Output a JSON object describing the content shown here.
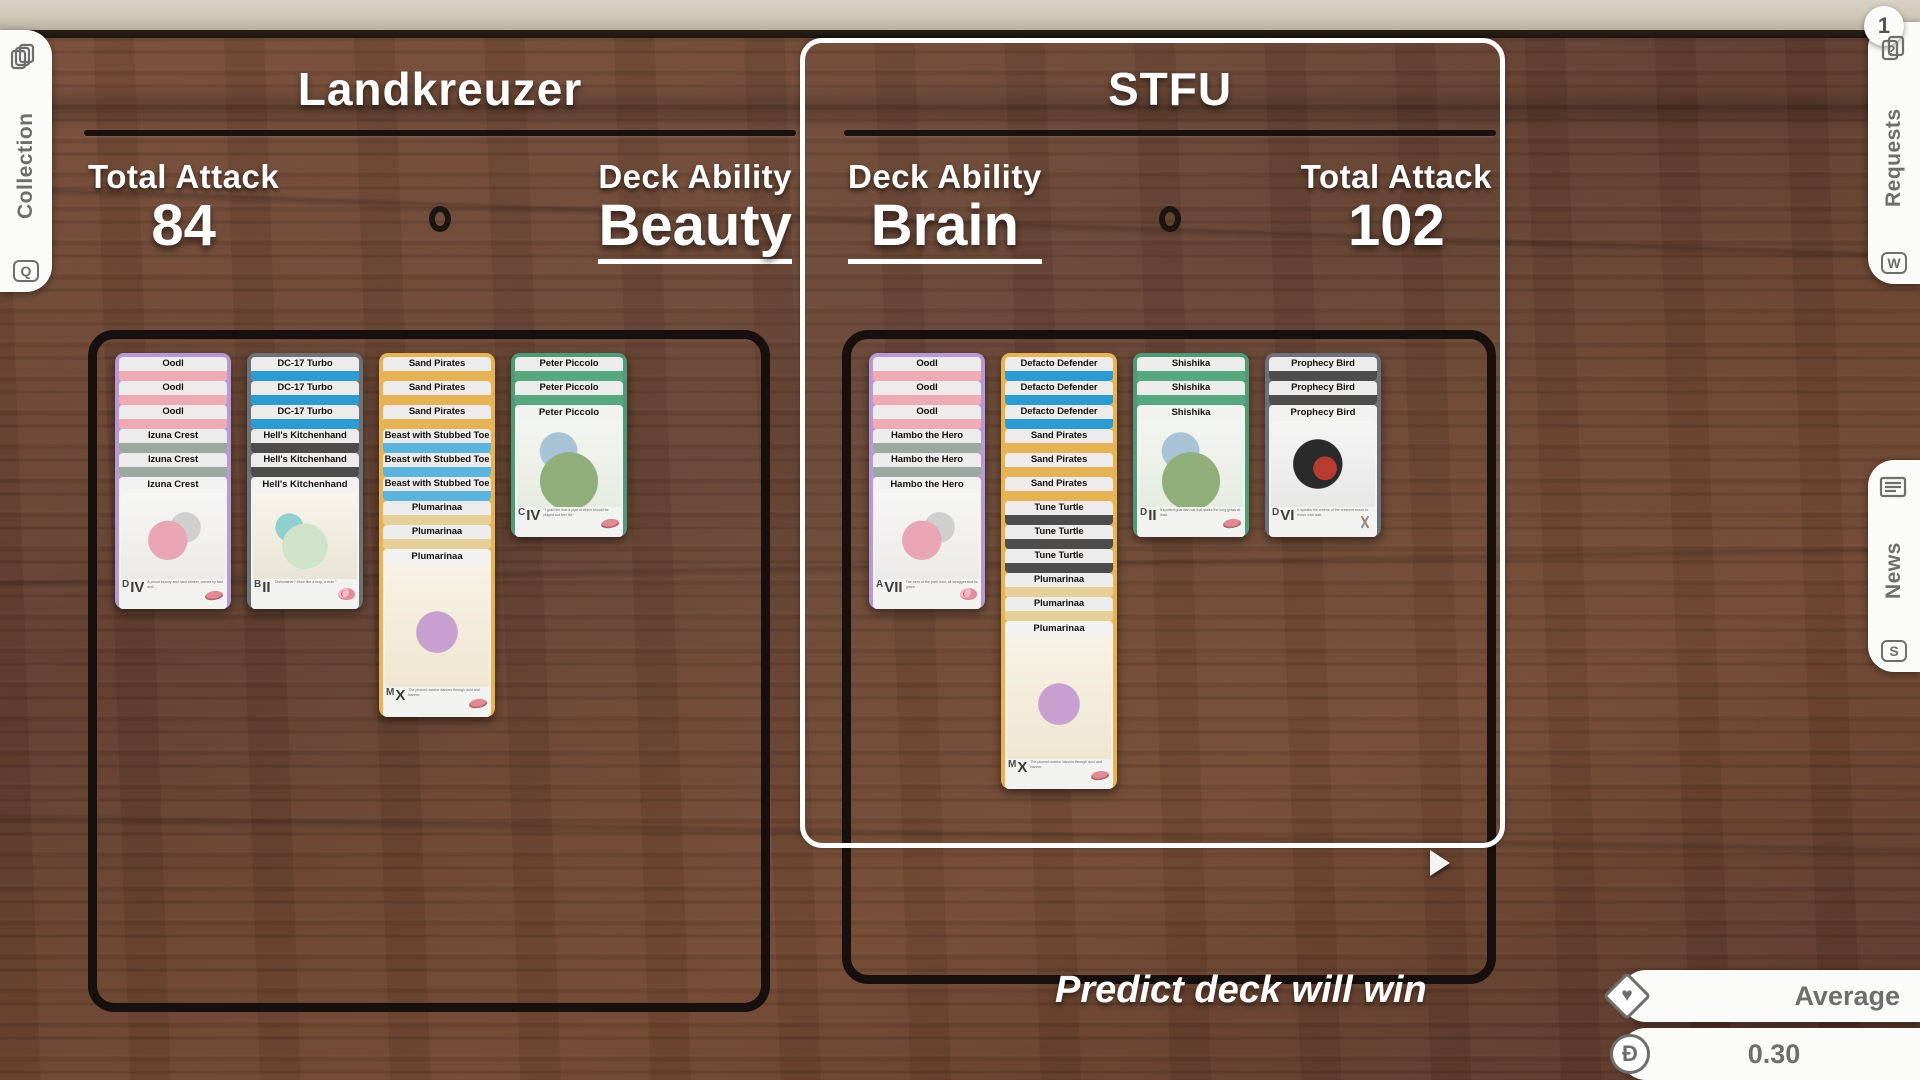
{
  "side_tabs": {
    "left": [
      {
        "name": "Collection",
        "label": "Collection",
        "key": "Q",
        "icon": "cards-stack-icon"
      }
    ],
    "right": [
      {
        "name": "Requests",
        "label": "Requests",
        "key": "W",
        "icon": "question-cards-icon",
        "badge": "1"
      },
      {
        "name": "News",
        "label": "News",
        "key": "S",
        "icon": "newspaper-icon"
      }
    ]
  },
  "decks": [
    {
      "title": "Landkreuzer",
      "selected": false,
      "left_stat_label": "Total Attack",
      "left_stat_value": "84",
      "right_stat_label": "Deck Ability",
      "right_stat_value": "Beauty",
      "stacks": [
        {
          "theme": "th-purple",
          "cards": [
            "Oodl",
            "Oodl",
            "Oodl",
            "Izuna Crest",
            "Izuna Crest",
            "Izuna Crest"
          ],
          "strip_colors": [
            "#f0aab4",
            "#f0aab4",
            "#f0aab4",
            "#9aa8a0",
            "#9aa8a0",
            "#9aa8a0"
          ],
          "rank": "D",
          "romans": "IV",
          "foot_desc": "A proud beauty and hard drinker, comes by fast and...",
          "suit": "lips"
        },
        {
          "theme": "th-gray",
          "cards": [
            "DC-17 Turbo",
            "DC-17 Turbo",
            "DC-17 Turbo",
            "Hell's Kitchenhand",
            "Hell's Kitchenhand",
            "Hell's Kitchenhand"
          ],
          "strip_colors": [
            "#2b9bd1",
            "#2b9bd1",
            "#2b9bd1",
            "#4c4c4c",
            "#4c4c4c",
            "#4c4c4c"
          ],
          "rank": "B",
          "romans": "II",
          "foot_desc": "\"Dishwasher? More like a mop, a man.\"",
          "suit": "brain"
        },
        {
          "theme": "th-yellow",
          "cards": [
            "Sand Pirates",
            "Sand Pirates",
            "Sand Pirates",
            "Beast with Stubbed Toe",
            "Beast with Stubbed Toe",
            "Beast with Stubbed Toe",
            "Plumarinaa",
            "Plumarinaa",
            "Plumarinaa"
          ],
          "strip_colors": [
            "#e7b256",
            "#e7b256",
            "#e7b256",
            "#5bb4dd",
            "#5bb4dd",
            "#5bb4dd",
            "#e7cf9a",
            "#e7cf9a",
            "#e7cf9a"
          ],
          "rank": "M",
          "romans": "X",
          "foot_desc": "The plumed warrior dances through dust and banner.",
          "suit": "lips",
          "tall": true
        },
        {
          "theme": "th-green",
          "cards": [
            "Peter Piccolo",
            "Peter Piccolo",
            "Peter Piccolo"
          ],
          "strip_colors": [
            "#57a87e",
            "#57a87e",
            "#57a87e"
          ],
          "rank": "C",
          "romans": "IV",
          "foot_desc": "\"I gold him that a pipe in which should be played out feel far.\"",
          "suit": "lips"
        }
      ]
    },
    {
      "title": "STFU",
      "selected": true,
      "left_stat_label": "Deck Ability",
      "left_stat_value": "Brain",
      "right_stat_label": "Total Attack",
      "right_stat_value": "102",
      "stacks": [
        {
          "theme": "th-purple",
          "cards": [
            "Oodl",
            "Oodl",
            "Oodl",
            "Hambo the Hero",
            "Hambo the Hero",
            "Hambo the Hero"
          ],
          "strip_colors": [
            "#f0aab4",
            "#f0aab4",
            "#f0aab4",
            "#9aa8a0",
            "#9aa8a0",
            "#9aa8a0"
          ],
          "rank": "A",
          "romans": "VII",
          "foot_desc": "The hero of the pork land, all swagger and no grace.",
          "suit": "brain"
        },
        {
          "theme": "th-yellow",
          "cards": [
            "Defacto Defender",
            "Defacto Defender",
            "Defacto Defender",
            "Sand Pirates",
            "Sand Pirates",
            "Sand Pirates",
            "Tune Turtle",
            "Tune Turtle",
            "Tune Turtle",
            "Plumarinaa",
            "Plumarinaa",
            "Plumarinaa"
          ],
          "strip_colors": [
            "#2b9bd1",
            "#2b9bd1",
            "#2b9bd1",
            "#e7b256",
            "#e7b256",
            "#e7b256",
            "#4c4c4c",
            "#4c4c4c",
            "#4c4c4c",
            "#e7cf9a",
            "#e7cf9a",
            "#e7cf9a"
          ],
          "rank": "M",
          "romans": "X",
          "foot_desc": "The plumed warrior dances through dust and banner.",
          "suit": "lips",
          "tall": true
        },
        {
          "theme": "th-green",
          "cards": [
            "Shishika",
            "Shishika",
            "Shishika"
          ],
          "strip_colors": [
            "#57a87e",
            "#57a87e",
            "#57a87e"
          ],
          "rank": "D",
          "romans": "II",
          "foot_desc": "A spotted guardian cat that stalks the long grass at dusk.",
          "suit": "lips"
        },
        {
          "theme": "th-slate",
          "cards": [
            "Prophecy Bird",
            "Prophecy Bird",
            "Prophecy Bird"
          ],
          "strip_colors": [
            "#4c4c4c",
            "#4c4c4c",
            "#8e9a94"
          ],
          "rank": "D",
          "romans": "VI",
          "foot_desc": "It speaks the omens of the crescent moon to those who wait.",
          "suit": "swords"
        }
      ]
    }
  ],
  "bottom": {
    "predict_text": "Predict deck will win",
    "average_label": "Average",
    "average_icon": "diamond-heart-icon",
    "coin_value": "0.30",
    "coin_icon": "dogecoin-icon",
    "coin_symbol": "Ð"
  },
  "cursor": {
    "icon": "pointer-arrow-icon"
  }
}
